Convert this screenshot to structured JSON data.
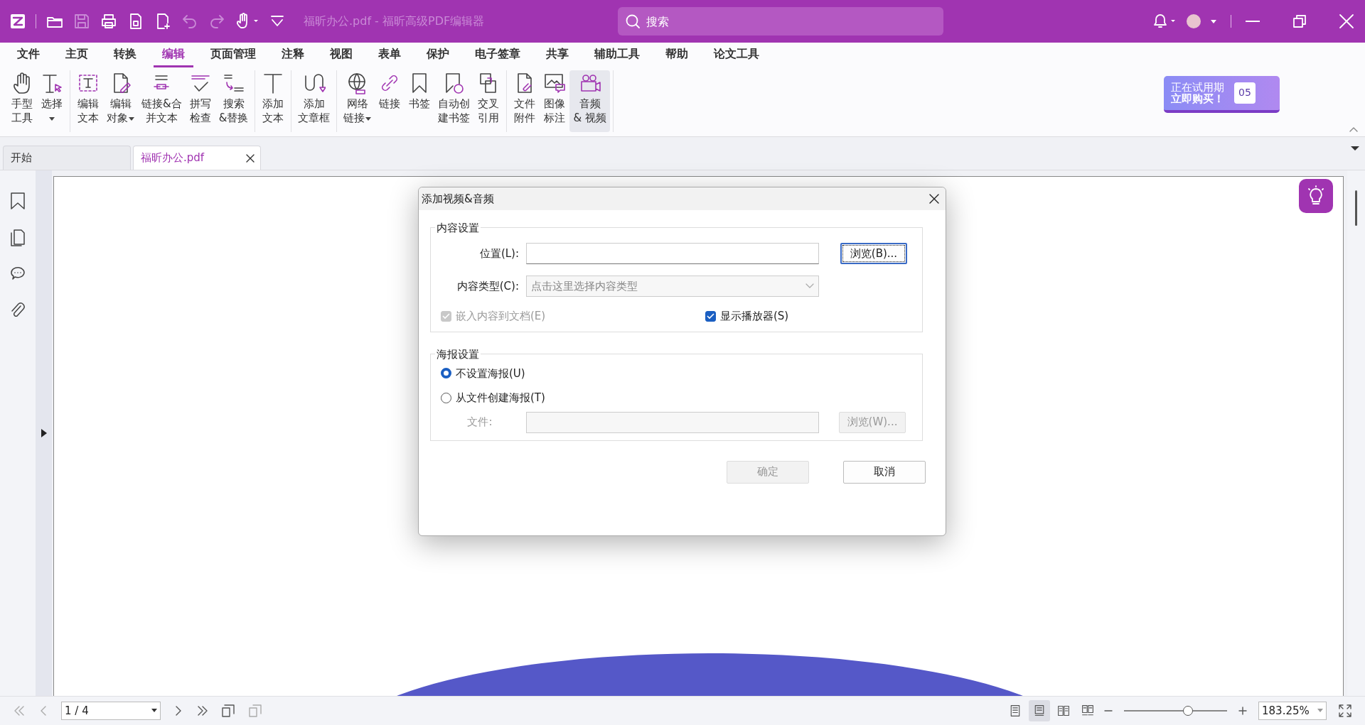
{
  "title_bar": {
    "title": "福昕办公.pdf - 福昕高级PDF编辑器",
    "search": {
      "placeholder": "搜索"
    }
  },
  "menu": [
    {
      "label": "文件",
      "selected": false
    },
    {
      "label": "主页",
      "selected": false
    },
    {
      "label": "转换",
      "selected": false
    },
    {
      "label": "编辑",
      "selected": true
    },
    {
      "label": "页面管理",
      "selected": false
    },
    {
      "label": "注释",
      "selected": false
    },
    {
      "label": "视图",
      "selected": false
    },
    {
      "label": "表单",
      "selected": false
    },
    {
      "label": "保护",
      "selected": false
    },
    {
      "label": "电子签章",
      "selected": false
    },
    {
      "label": "共享",
      "selected": false
    },
    {
      "label": "辅助工具",
      "selected": false
    },
    {
      "label": "帮助",
      "selected": false
    },
    {
      "label": "论文工具",
      "selected": false
    }
  ],
  "ribbon": [
    {
      "items": [
        {
          "lines": [
            "手型",
            "工具"
          ],
          "dropdown": false,
          "selected": false
        },
        {
          "lines": [
            "选择"
          ],
          "dropdown": true,
          "selected": false
        }
      ]
    },
    {
      "items": [
        {
          "lines": [
            "编辑",
            "文本"
          ],
          "dropdown": false,
          "selected": false
        },
        {
          "lines": [
            "编辑",
            "对象"
          ],
          "dropdown": true,
          "selected": false
        },
        {
          "lines": [
            "链接&合",
            "并文本"
          ],
          "dropdown": false,
          "selected": false
        },
        {
          "lines": [
            "拼写",
            "检查"
          ],
          "dropdown": false,
          "selected": false
        },
        {
          "lines": [
            "搜索",
            "&替换"
          ],
          "dropdown": false,
          "selected": false
        }
      ]
    },
    {
      "items": [
        {
          "lines": [
            "添加",
            "文本"
          ],
          "dropdown": false,
          "selected": false
        }
      ]
    },
    {
      "items": [
        {
          "lines": [
            "添加",
            "文章框"
          ],
          "dropdown": false,
          "selected": false
        }
      ]
    },
    {
      "items": [
        {
          "lines": [
            "网络",
            "链接"
          ],
          "dropdown": true,
          "selected": false
        },
        {
          "lines": [
            "链接"
          ],
          "dropdown": false,
          "selected": false
        },
        {
          "lines": [
            "书签"
          ],
          "dropdown": false,
          "selected": false
        },
        {
          "lines": [
            "自动创",
            "建书签"
          ],
          "dropdown": false,
          "selected": false
        },
        {
          "lines": [
            "交叉",
            "引用"
          ],
          "dropdown": false,
          "selected": false
        }
      ]
    },
    {
      "items": [
        {
          "lines": [
            "文件",
            "附件"
          ],
          "dropdown": false,
          "selected": false
        },
        {
          "lines": [
            "图像",
            "标注"
          ],
          "dropdown": false,
          "selected": false
        },
        {
          "lines": [
            "音频",
            "& 视频"
          ],
          "dropdown": false,
          "selected": true
        }
      ]
    }
  ],
  "trial_badge": {
    "line_1": "正在试用期",
    "line_2": "立即购买！",
    "days": "05"
  },
  "doc_tabs": [
    {
      "label": "开始",
      "selected": false,
      "closable": false
    },
    {
      "label": "福昕办公.pdf",
      "selected": true,
      "closable": true
    }
  ],
  "dialog": {
    "title": "添加视频&音频",
    "content_group": {
      "legend": "内容设置",
      "location_label": "位置(L):",
      "browse_button": "浏览(B)...",
      "type_label": "内容类型(C):",
      "type_value": "点击这里选择内容类型",
      "type_disabled": true,
      "checkboxes": [
        {
          "label": "嵌入内容到文档(E)",
          "checked": true,
          "disabled": true
        },
        {
          "label": "显示播放器(S)",
          "checked": true,
          "disabled": false
        }
      ]
    },
    "poster_group": {
      "legend": "海报设置",
      "options": [
        {
          "label": "不设置海报(U)",
          "selected": true
        },
        {
          "label": "从文件创建海报(T)",
          "selected": false
        }
      ],
      "file_label": "文件:",
      "file_disabled": true,
      "browse_button": "浏览(W)..."
    },
    "buttons": [
      {
        "label": "确定",
        "disabled": true
      },
      {
        "label": "取消",
        "disabled": false
      }
    ]
  },
  "status_bar": {
    "page": "1 / 4",
    "views": [
      {
        "selected": false
      },
      {
        "selected": true
      },
      {
        "selected": false
      },
      {
        "selected": false
      }
    ],
    "zoom_slider": {
      "level": 0.62
    },
    "zoom": "183.25%"
  }
}
